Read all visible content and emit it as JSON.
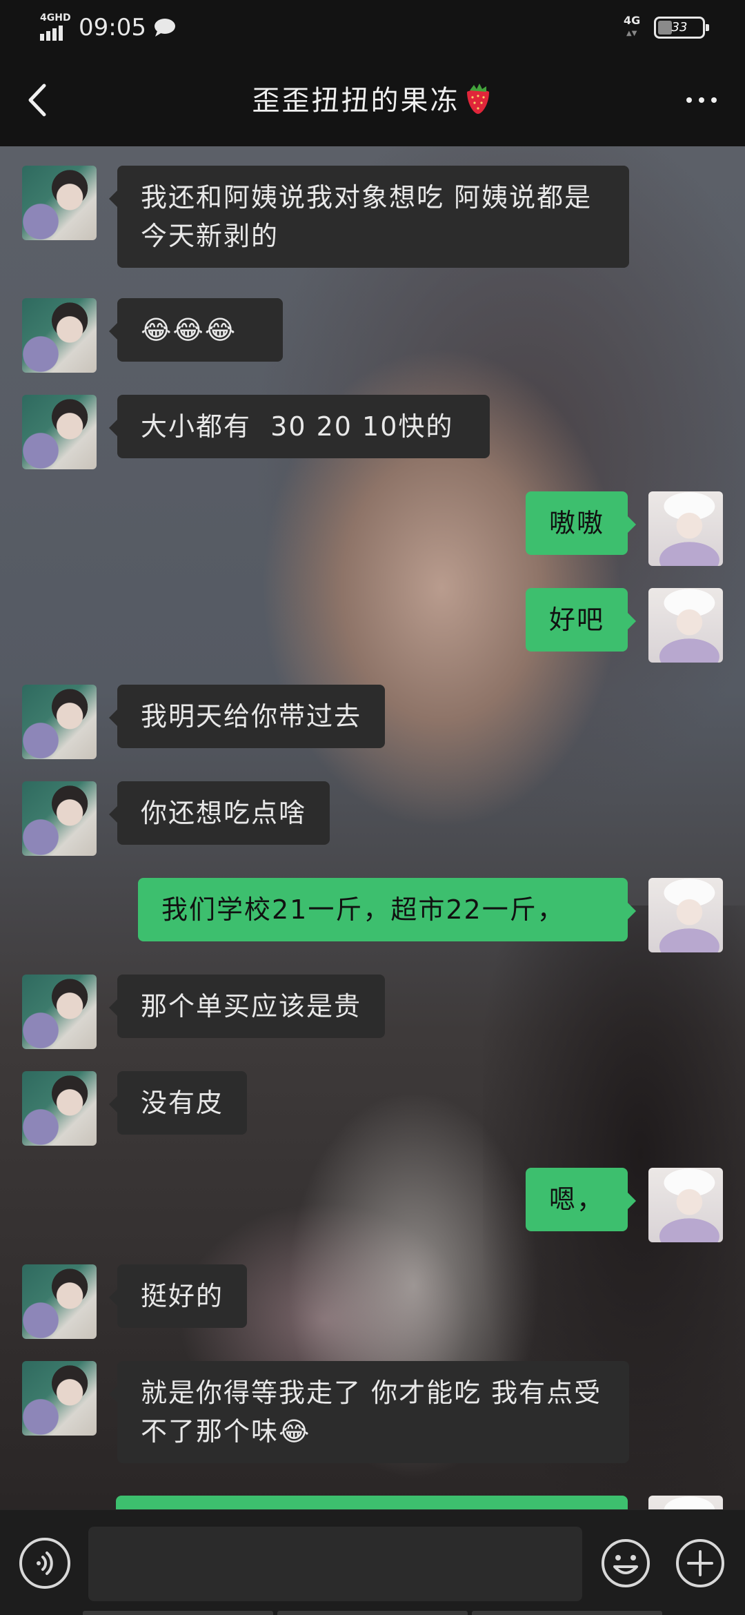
{
  "status_bar": {
    "network_label": "4GHD",
    "time": "09:05",
    "right_network": "4G",
    "battery_level": "33"
  },
  "header": {
    "title": "歪歪扭扭的果冻"
  },
  "messages": [
    {
      "side": "left",
      "text": "我还和阿姨说我对象想吃 阿姨说都是今天新剥的"
    },
    {
      "side": "left",
      "text": "😂😂😂"
    },
    {
      "side": "left",
      "text": "大小都有  30 20 10快的"
    },
    {
      "side": "right",
      "text": "嗷嗷"
    },
    {
      "side": "right",
      "text": "好吧"
    },
    {
      "side": "left",
      "text": "我明天给你带过去"
    },
    {
      "side": "left",
      "text": "你还想吃点啥"
    },
    {
      "side": "right",
      "text": "我们学校21一斤，超市22一斤，"
    },
    {
      "side": "left",
      "text": "那个单买应该是贵"
    },
    {
      "side": "left",
      "text": "没有皮"
    },
    {
      "side": "right",
      "text": "嗯，"
    },
    {
      "side": "left",
      "text": "挺好的"
    },
    {
      "side": "left",
      "text": "就是你得等我走了 你才能吃  我有点受不了那个味😂"
    },
    {
      "side": "right",
      "text": ""
    }
  ],
  "input": {
    "value": ""
  }
}
